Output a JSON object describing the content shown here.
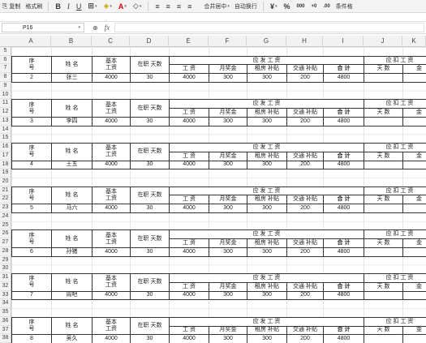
{
  "toolbar": {
    "copy_label": "复制",
    "format_painter_label": "格式刷",
    "bold": "B",
    "italic": "I",
    "underline": "U",
    "font_color_glyph": "A",
    "merge_center_label": "合并居中",
    "wrap_label": "自动换行",
    "currency_glyph": "¥",
    "percent_glyph": "%",
    "conditional_label": "条件格"
  },
  "formula_bar": {
    "cell_ref": "P16",
    "fx": "fx",
    "formula": ""
  },
  "columns": [
    "A",
    "B",
    "C",
    "D",
    "E",
    "F",
    "G",
    "H",
    "I",
    "J",
    "K"
  ],
  "rows_visible": [
    "5",
    "6",
    "7",
    "8",
    "9",
    "10",
    "11",
    "12",
    "13",
    "14",
    "15",
    "16",
    "17",
    "18",
    "19",
    "20",
    "21",
    "22",
    "23",
    "24",
    "25",
    "26",
    "27",
    "28",
    "29",
    "30",
    "31",
    "32",
    "33",
    "34",
    "35",
    "36",
    "37",
    "38"
  ],
  "header_labels": {
    "seq": "序\n号",
    "name": "姓  名",
    "base_salary": "基本\n工资",
    "days_worked": "在职  天数",
    "payable": "应 发 工 资",
    "deduct": "应 扣 工 资",
    "wage": "工  资",
    "monthly_bonus": "月奖金",
    "rent_allow": "租房   补贴",
    "transport_allow": "交通   补贴",
    "total": "合  计",
    "days": "天  数",
    "amount": "金"
  },
  "records": [
    {
      "seq": "2",
      "name": "张三",
      "base": "4000",
      "days": "30",
      "wage": "4000",
      "bonus": "300",
      "rent": "300",
      "transport": "200",
      "total": "4800"
    },
    {
      "seq": "3",
      "name": "李四",
      "base": "4000",
      "days": "30",
      "wage": "4000",
      "bonus": "300",
      "rent": "300",
      "transport": "200",
      "total": "4800"
    },
    {
      "seq": "4",
      "name": "王五",
      "base": "4000",
      "days": "30",
      "wage": "4000",
      "bonus": "300",
      "rent": "300",
      "transport": "200",
      "total": "4800"
    },
    {
      "seq": "5",
      "name": "马六",
      "base": "4000",
      "days": "30",
      "wage": "4000",
      "bonus": "300",
      "rent": "300",
      "transport": "200",
      "total": "4800"
    },
    {
      "seq": "6",
      "name": "孙猪",
      "base": "4000",
      "days": "30",
      "wage": "4000",
      "bonus": "300",
      "rent": "300",
      "transport": "200",
      "total": "4800"
    },
    {
      "seq": "7",
      "name": "周吧",
      "base": "4000",
      "days": "30",
      "wage": "4000",
      "bonus": "300",
      "rent": "300",
      "transport": "200",
      "total": "4800"
    },
    {
      "seq": "8",
      "name": "吴久",
      "base": "4000",
      "days": "30",
      "wage": "4000",
      "bonus": "300",
      "rent": "300",
      "transport": "200",
      "total": "4800"
    }
  ]
}
